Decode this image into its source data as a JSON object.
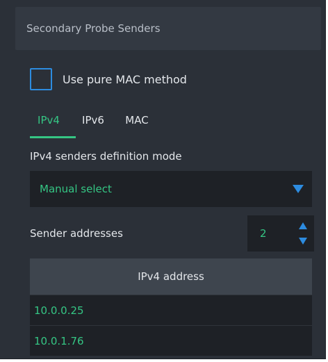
{
  "panel": {
    "title": "Secondary Probe Senders"
  },
  "pure_mac": {
    "label": "Use pure MAC method",
    "checked": false
  },
  "tabs": [
    {
      "label": "IPv4",
      "active": true
    },
    {
      "label": "IPv6",
      "active": false
    },
    {
      "label": "MAC",
      "active": false
    }
  ],
  "definition_mode": {
    "label": "IPv4 senders definition mode",
    "value": "Manual select",
    "arrow_icon": "triangle-down-icon"
  },
  "sender_addresses": {
    "label": "Sender addresses",
    "count": "2",
    "up_icon": "triangle-up-icon",
    "down_icon": "triangle-down-icon"
  },
  "table": {
    "header": "IPv4 address",
    "rows": [
      "10.0.0.25",
      "10.0.1.76"
    ]
  },
  "colors": {
    "accent_green": "#35c684",
    "accent_blue": "#2d8ce0",
    "panel_bg": "#2b3038",
    "field_bg": "#1e2126"
  }
}
